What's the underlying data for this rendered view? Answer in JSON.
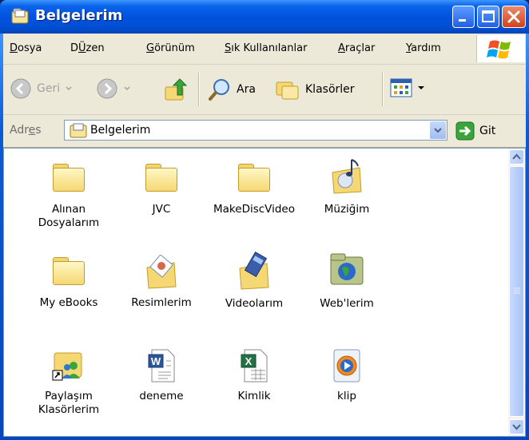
{
  "window": {
    "title": "Belgelerim"
  },
  "menu": [
    {
      "label": "Dosya",
      "accel": "D",
      "rest": "osya"
    },
    {
      "label": "Düzen",
      "accel": "Ü",
      "rest": "zen",
      "prefix": "D"
    },
    {
      "label": "Görünüm",
      "accel": "G",
      "rest": "örünüm"
    },
    {
      "label": "Sık Kullanılanlar",
      "accel": "S",
      "rest": "ık Kullanılanlar"
    },
    {
      "label": "Araçlar",
      "accel": "A",
      "rest": "raçlar"
    },
    {
      "label": "Yardım",
      "accel": "Y",
      "rest": "ardım"
    }
  ],
  "toolbar": {
    "back_label": "Geri",
    "search_label": "Ara",
    "folders_label": "Klasörler"
  },
  "address": {
    "label_prefix": "Adr",
    "label_accel": "e",
    "label_suffix": "s",
    "value": "Belgelerim",
    "go_label": "Git"
  },
  "items": [
    {
      "name": "Alınan\nDosyalarım",
      "line1": "Alınan",
      "line2": "Dosyalarım",
      "icon": "folder-icon"
    },
    {
      "name": "JVC",
      "line1": "JVC",
      "line2": "",
      "icon": "folder-icon"
    },
    {
      "name": "MakeDiscVideo",
      "line1": "MakeDiscVideo",
      "line2": "",
      "icon": "folder-icon"
    },
    {
      "name": "Müziğim",
      "line1": "Müziğim",
      "line2": "",
      "icon": "music-folder-icon"
    },
    {
      "name": "My eBooks",
      "line1": "My eBooks",
      "line2": "",
      "icon": "folder-icon"
    },
    {
      "name": "Resimlerim",
      "line1": "Resimlerim",
      "line2": "",
      "icon": "pictures-folder-icon"
    },
    {
      "name": "Videolarım",
      "line1": "Videolarım",
      "line2": "",
      "icon": "video-folder-icon"
    },
    {
      "name": "Web'lerim",
      "line1": "Web'lerim",
      "line2": "",
      "icon": "web-folder-icon"
    },
    {
      "name": "Paylaşım Klasörlerim",
      "line1": "Paylaşım",
      "line2": "Klasörlerim",
      "icon": "shared-folder-shortcut-icon"
    },
    {
      "name": "deneme",
      "line1": "deneme",
      "line2": "",
      "icon": "word-document-icon"
    },
    {
      "name": "Kimlik",
      "line1": "Kimlik",
      "line2": "",
      "icon": "excel-document-icon"
    },
    {
      "name": "klip",
      "line1": "klip",
      "line2": "",
      "icon": "media-file-icon"
    }
  ],
  "colors": {
    "titlebar": "#0053df",
    "client": "#ece9d8",
    "folder": "#f5d873"
  }
}
